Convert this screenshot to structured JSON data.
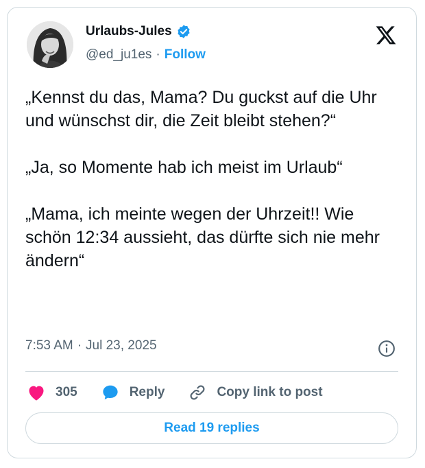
{
  "author": {
    "display_name": "Urlaubs-Jules",
    "handle": "@ed_ju1es",
    "separator": "·",
    "follow_label": "Follow",
    "verified_color": "#1d9bf0"
  },
  "tweet": {
    "text": "„Kennst du das, Mama? Du guckst auf die Uhr und wünschst dir, die Zeit bleibt stehen?“\n\n„Ja, so Momente hab ich meist im Urlaub“\n\n„Mama, ich meinte wegen der Uhrzeit!! Wie schön 12:34 aussieht, das dürfte sich nie mehr ändern“",
    "time": "7:53 AM",
    "separator": "·",
    "date": "Jul 23, 2025"
  },
  "actions": {
    "like_count": "305",
    "reply_label": "Reply",
    "copy_link_label": "Copy link to post",
    "like_color": "#f91880",
    "reply_color": "#1d9bf0"
  },
  "read_replies_label": "Read 19 replies",
  "icons": [
    "verified-badge-icon",
    "x-logo-icon",
    "info-icon",
    "heart-icon",
    "reply-bubble-icon",
    "link-icon"
  ]
}
